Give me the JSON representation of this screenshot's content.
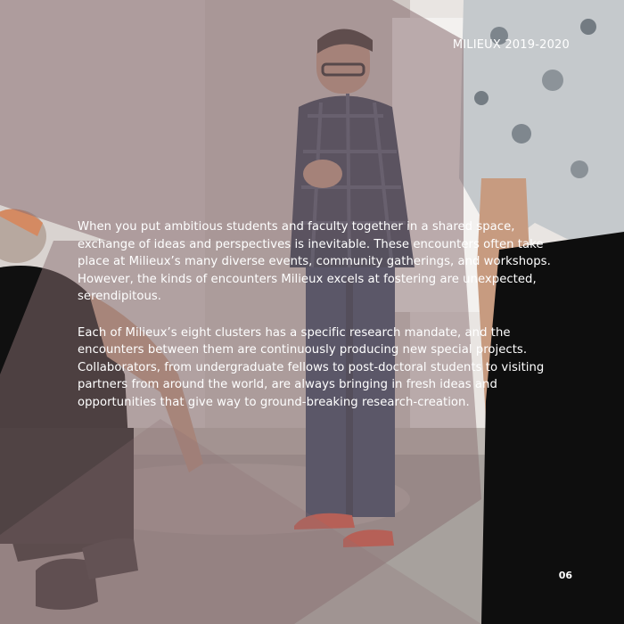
{
  "header": {
    "label": "MILIEUX 2019-2020"
  },
  "body": {
    "paragraphs": [
      "When you put ambitious students and faculty together in a shared space, exchange of ideas and perspectives is inevitable. These encounters often take place at Milieux’s many diverse events, community gatherings, and workshops. However, the kinds of encounters Milieux excels at fostering are unexpected, serendipitous.",
      "Each of Milieux’s eight clusters has a specific research mandate, and the encounters between them are continuously producing new special projects. Collaborators, from undergraduate fellows to post-doctoral students to visiting partners from around the world, are always bringing in fresh ideas and opportunities that give way to ground-breaking research-creation."
    ]
  },
  "footer": {
    "page_number": "06"
  },
  "colors": {
    "overlay": "#8a6f72",
    "text": "#ffffff"
  }
}
